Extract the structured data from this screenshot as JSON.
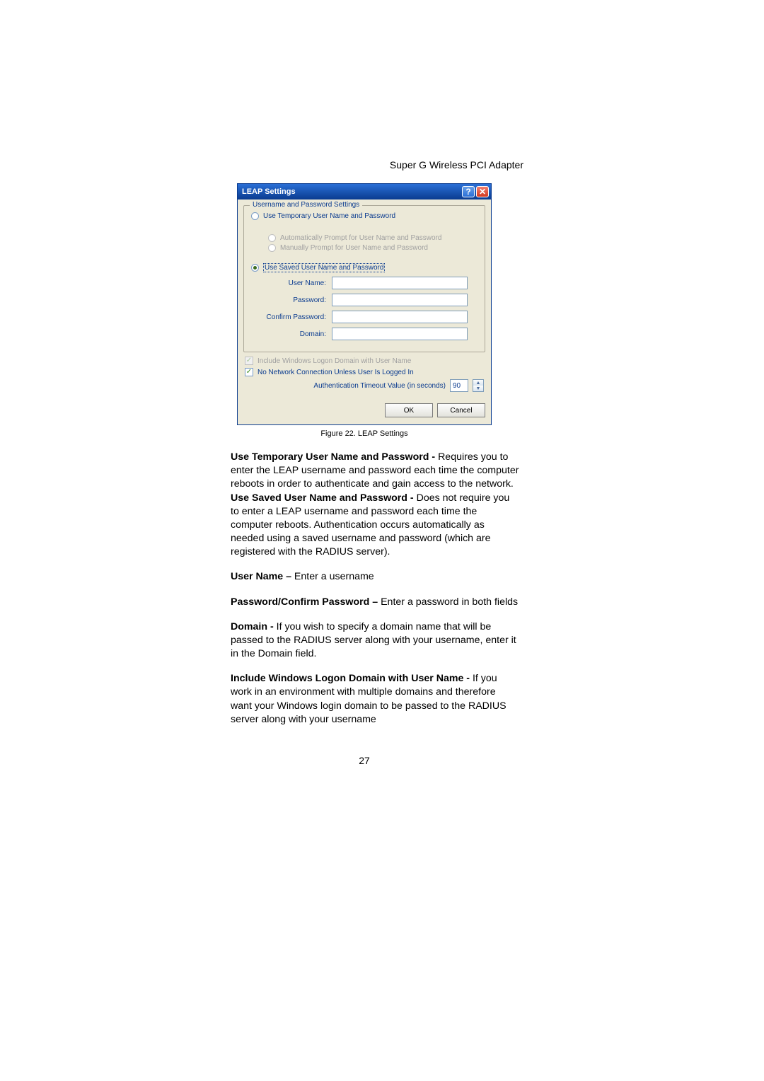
{
  "header": "Super G Wireless PCI Adapter",
  "dialog": {
    "title": "LEAP Settings",
    "group_legend": "Username and Password Settings",
    "radio_temp": "Use Temporary User Name and Password",
    "sub_auto": "Automatically Prompt for User Name and Password",
    "sub_manual": "Manually Prompt for User Name and Password",
    "radio_saved": "Use Saved User Name and Password",
    "fields": {
      "user": "User Name:",
      "pass": "Password:",
      "confirm": "Confirm Password:",
      "domain": "Domain:"
    },
    "check_include": "Include Windows Logon Domain with User Name",
    "check_nonet": "No Network Connection Unless User Is Logged In",
    "timeout_label": "Authentication Timeout Value (in seconds)",
    "timeout_value": "90",
    "ok": "OK",
    "cancel": "Cancel"
  },
  "caption": "Figure 22. LEAP Settings",
  "para1_bold": "Use Temporary User Name and Password - ",
  "para1_rest": "Requires you to enter the LEAP username and password each time the computer reboots in order to authenticate and gain access to the network.",
  "para2_bold": "Use Saved User Name and Password - ",
  "para2_rest": "Does not require you to enter a LEAP username and password each time the computer reboots. Authentication occurs automatically as needed using a saved username and password (which are registered with the RADIUS server).",
  "para3_bold": "User Name – ",
  "para3_rest": "Enter a username",
  "para4_bold": "Password/Confirm Password – ",
  "para4_rest": "Enter a password in both fields",
  "para5_bold": "Domain - ",
  "para5_rest": "If you wish to specify a domain name that will be passed to the RADIUS server along with your username, enter it in the Domain field.",
  "para6_bold": "Include Windows Logon Domain with User Name - ",
  "para6_rest": "If you work in an environment with multiple domains and therefore want your Windows login domain to be passed to the RADIUS server along with your username",
  "page_number": "27"
}
